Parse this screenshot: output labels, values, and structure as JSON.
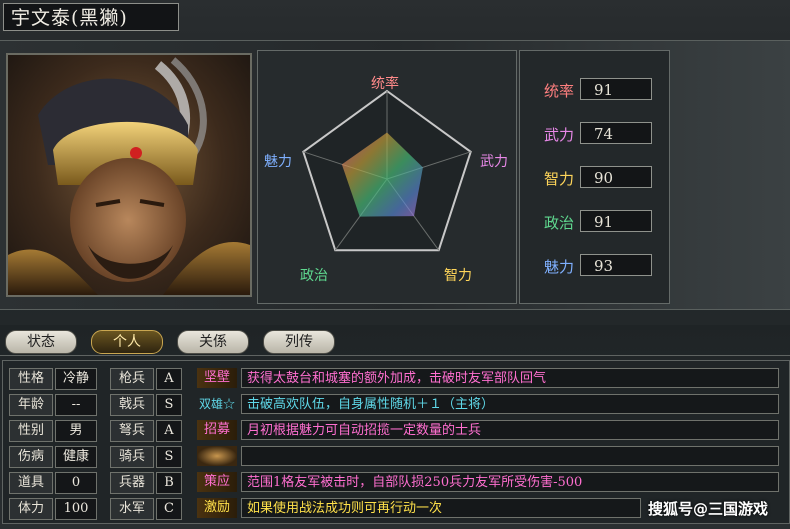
{
  "header": {
    "title": "宇文泰(黑獭)"
  },
  "radar": {
    "labels": {
      "top": "统率",
      "right": "武力",
      "bottom_right": "智力",
      "bottom_left": "政治",
      "left": "魅力"
    },
    "values": [
      91,
      74,
      90,
      91,
      93
    ]
  },
  "stats": [
    {
      "label": "统率",
      "value": "91",
      "color": "#ff7f7f"
    },
    {
      "label": "武力",
      "value": "74",
      "color": "#e888e8"
    },
    {
      "label": "智力",
      "value": "90",
      "color": "#ffd65a"
    },
    {
      "label": "政治",
      "value": "91",
      "color": "#5fd88f"
    },
    {
      "label": "魅力",
      "value": "93",
      "color": "#7fb0ff"
    }
  ],
  "tabs": [
    "状态",
    "个人",
    "关係",
    "列传"
  ],
  "active_tab": "个人",
  "personal": [
    {
      "label": "性格",
      "value": "冷静"
    },
    {
      "label": "年龄",
      "value": "--"
    },
    {
      "label": "性别",
      "value": "男"
    },
    {
      "label": "伤病",
      "value": "健康"
    },
    {
      "label": "道具",
      "value": "0"
    },
    {
      "label": "体力",
      "value": "100"
    }
  ],
  "aptitude": [
    {
      "label": "枪兵",
      "value": "A"
    },
    {
      "label": "戟兵",
      "value": "S"
    },
    {
      "label": "弩兵",
      "value": "A"
    },
    {
      "label": "骑兵",
      "value": "S"
    },
    {
      "label": "兵器",
      "value": "B"
    },
    {
      "label": "水军",
      "value": "C"
    }
  ],
  "skills": [
    {
      "name": "坚壁",
      "desc": "获得太鼓台和城塞的额外加成，击破时友军部队回气",
      "name_color": "#ff6fd0",
      "desc_color": "#ff6fd0"
    },
    {
      "name": "双雄☆",
      "desc": "击破高欢队伍，自身属性随机＋１（主将）",
      "name_color": "#5fd8e8",
      "desc_color": "#5fd8e8"
    },
    {
      "name": "招募",
      "desc": "月初根据魅力可自动招揽一定数量的士兵",
      "name_color": "#ff6fd0",
      "desc_color": "#ff6fd0"
    },
    {
      "name": "",
      "desc": "",
      "name_color": "#c8a060",
      "desc_color": "#ffffff"
    },
    {
      "name": "策应",
      "desc": "范围1格友军被击时，自部队损250兵力友军所受伤害-500",
      "name_color": "#ff6fd0",
      "desc_color": "#ff6fd0"
    },
    {
      "name": "激励",
      "desc": "如果使用战法成功则可再行动一次",
      "name_color": "#ffe14a",
      "desc_color": "#ffe14a"
    }
  ],
  "watermark": "搜狐号@三国游戏"
}
